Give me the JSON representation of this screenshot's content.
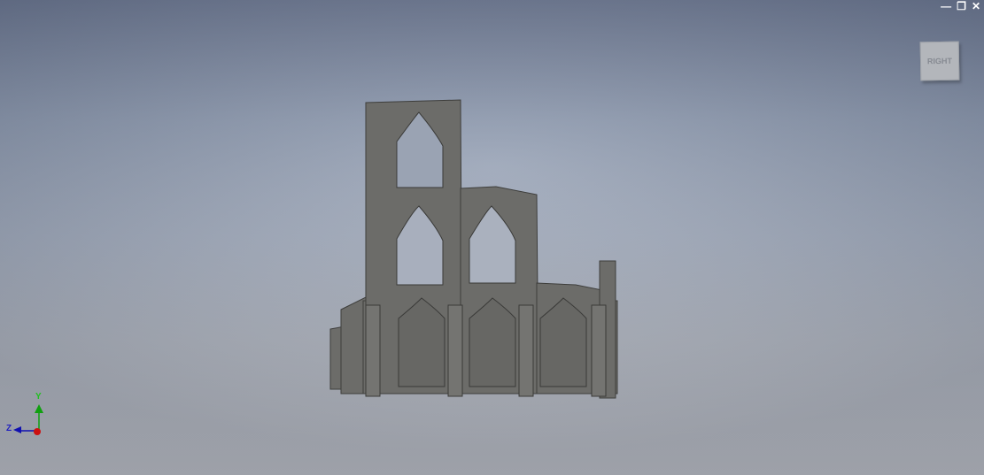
{
  "window_controls": {
    "minimize": "—",
    "restore": "❐",
    "close": "✕"
  },
  "view_cube": {
    "face_label": "RIGHT"
  },
  "triad": {
    "y_label": "Y",
    "z_label": "Z",
    "colors": {
      "x": "#cc1010",
      "y": "#10a010",
      "z": "#1010b0"
    }
  },
  "model": {
    "color": "#6b6b68"
  }
}
